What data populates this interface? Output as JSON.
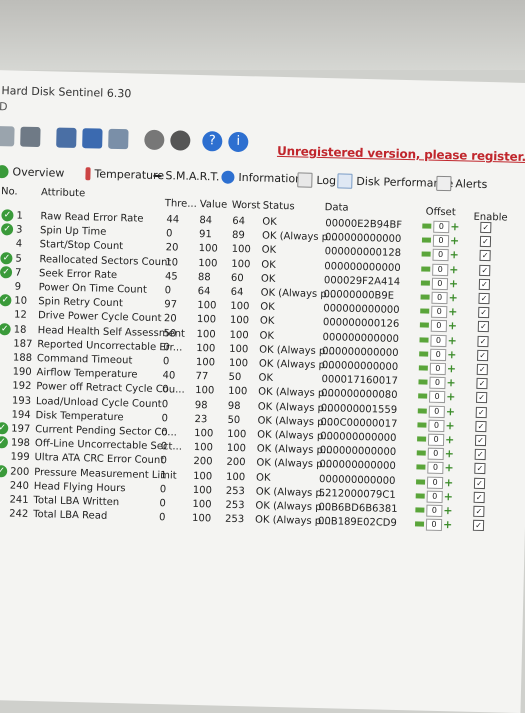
{
  "window_title": "Hard Disk Sentinel 6.30",
  "window_sub": "D",
  "unregistered": "Unregistered version, please register.",
  "tabs": [
    {
      "label": "Overview",
      "icon": "check-circle-icon"
    },
    {
      "label": "Temperature",
      "icon": "thermometer-icon"
    },
    {
      "label": "S.M.A.R.T.",
      "icon": "dash-icon"
    },
    {
      "label": "Information",
      "icon": "info-icon"
    },
    {
      "label": "Log",
      "icon": "document-icon"
    },
    {
      "label": "Disk Performance",
      "icon": "chart-icon"
    },
    {
      "label": "Alerts",
      "icon": "alert-icon"
    }
  ],
  "headers": {
    "no": "No.",
    "attribute": "Attribute",
    "threshold": "Thre...",
    "value": "Value",
    "worst": "Worst",
    "status": "Status",
    "data": "Data",
    "offset": "Offset",
    "enable": "Enable"
  },
  "offset_value": "0",
  "rows": [
    {
      "no": "1",
      "attribute": "Raw Read Error Rate",
      "threshold": "44",
      "value": "84",
      "worst": "64",
      "status": "OK",
      "data": "00000E2B94BF",
      "check": true
    },
    {
      "no": "3",
      "attribute": "Spin Up Time",
      "threshold": "0",
      "value": "91",
      "worst": "89",
      "status": "OK (Always p...",
      "data": "000000000000",
      "check": true
    },
    {
      "no": "4",
      "attribute": "Start/Stop Count",
      "threshold": "20",
      "value": "100",
      "worst": "100",
      "status": "OK",
      "data": "000000000128",
      "check": false
    },
    {
      "no": "5",
      "attribute": "Reallocated Sectors Count",
      "threshold": "10",
      "value": "100",
      "worst": "100",
      "status": "OK",
      "data": "000000000000",
      "check": true
    },
    {
      "no": "7",
      "attribute": "Seek Error Rate",
      "threshold": "45",
      "value": "88",
      "worst": "60",
      "status": "OK",
      "data": "000029F2A414",
      "check": true
    },
    {
      "no": "9",
      "attribute": "Power On Time Count",
      "threshold": "0",
      "value": "64",
      "worst": "64",
      "status": "OK (Always p...",
      "data": "00000000B9E",
      "check": false
    },
    {
      "no": "10",
      "attribute": "Spin Retry Count",
      "threshold": "97",
      "value": "100",
      "worst": "100",
      "status": "OK",
      "data": "000000000000",
      "check": true
    },
    {
      "no": "12",
      "attribute": "Drive Power Cycle Count",
      "threshold": "20",
      "value": "100",
      "worst": "100",
      "status": "OK",
      "data": "000000000126",
      "check": false
    },
    {
      "no": "18",
      "attribute": "Head Health Self Assessment",
      "threshold": "50",
      "value": "100",
      "worst": "100",
      "status": "OK",
      "data": "000000000000",
      "check": true
    },
    {
      "no": "187",
      "attribute": "Reported Uncorrectable Err...",
      "threshold": "0",
      "value": "100",
      "worst": "100",
      "status": "OK (Always p...",
      "data": "000000000000",
      "check": false
    },
    {
      "no": "188",
      "attribute": "Command Timeout",
      "threshold": "0",
      "value": "100",
      "worst": "100",
      "status": "OK (Always p...",
      "data": "000000000000",
      "check": false
    },
    {
      "no": "190",
      "attribute": "Airflow Temperature",
      "threshold": "40",
      "value": "77",
      "worst": "50",
      "status": "OK",
      "data": "000017160017",
      "check": false
    },
    {
      "no": "192",
      "attribute": "Power off Retract Cycle Cou...",
      "threshold": "0",
      "value": "100",
      "worst": "100",
      "status": "OK (Always p...",
      "data": "000000000080",
      "check": false
    },
    {
      "no": "193",
      "attribute": "Load/Unload Cycle Count",
      "threshold": "0",
      "value": "98",
      "worst": "98",
      "status": "OK (Always p...",
      "data": "000000001559",
      "check": false
    },
    {
      "no": "194",
      "attribute": "Disk Temperature",
      "threshold": "0",
      "value": "23",
      "worst": "50",
      "status": "OK (Always p...",
      "data": "000C00000017",
      "check": false
    },
    {
      "no": "197",
      "attribute": "Current Pending Sector Co...",
      "threshold": "0",
      "value": "100",
      "worst": "100",
      "status": "OK (Always p...",
      "data": "000000000000",
      "check": true
    },
    {
      "no": "198",
      "attribute": "Off-Line Uncorrectable Sect...",
      "threshold": "0",
      "value": "100",
      "worst": "100",
      "status": "OK (Always p...",
      "data": "000000000000",
      "check": true
    },
    {
      "no": "199",
      "attribute": "Ultra ATA CRC Error Count",
      "threshold": "0",
      "value": "200",
      "worst": "200",
      "status": "OK (Always p...",
      "data": "000000000000",
      "check": false
    },
    {
      "no": "200",
      "attribute": "Pressure Measurement Limit",
      "threshold": "1",
      "value": "100",
      "worst": "100",
      "status": "OK",
      "data": "000000000000",
      "check": true
    },
    {
      "no": "240",
      "attribute": "Head Flying Hours",
      "threshold": "0",
      "value": "100",
      "worst": "253",
      "status": "OK (Always p...",
      "data": "5212000079C1",
      "check": false
    },
    {
      "no": "241",
      "attribute": "Total LBA Written",
      "threshold": "0",
      "value": "100",
      "worst": "253",
      "status": "OK (Always p...",
      "data": "00B6BD6B6381",
      "check": false
    },
    {
      "no": "242",
      "attribute": "Total LBA Read",
      "threshold": "0",
      "value": "100",
      "worst": "253",
      "status": "OK (Always p...",
      "data": "00B189E02CD9",
      "check": false
    }
  ],
  "colors": {
    "ok_green": "#3a9a3a",
    "unregistered_red": "#c0262c"
  }
}
